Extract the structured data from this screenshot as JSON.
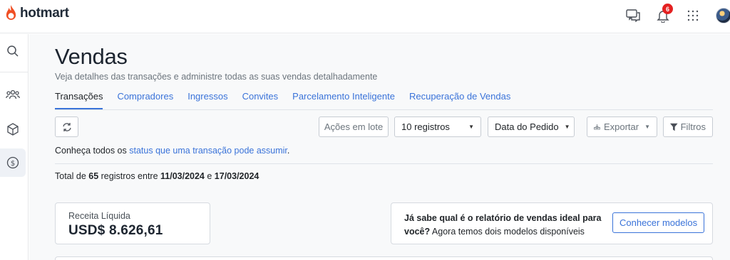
{
  "brand": {
    "name": "hotmart",
    "color": "#f04e23"
  },
  "header": {
    "notifications_count": "6"
  },
  "page": {
    "title": "Vendas",
    "subtitle": "Veja detalhes das transações e administre todas as suas vendas detalhadamente"
  },
  "tabs": [
    {
      "label": "Transações",
      "active": true
    },
    {
      "label": "Compradores"
    },
    {
      "label": "Ingressos"
    },
    {
      "label": "Convites"
    },
    {
      "label": "Parcelamento Inteligente"
    },
    {
      "label": "Recuperação de Vendas"
    }
  ],
  "toolbar": {
    "bulk_actions_label": "Ações em lote",
    "records_label": "10 registros",
    "date_label": "Data do Pedido",
    "export_label": "Exportar",
    "filters_label": "Filtros"
  },
  "info": {
    "prefix": "Conheça todos os ",
    "link": "status que uma transação pode assumir",
    "suffix": "."
  },
  "total": {
    "prefix": "Total de ",
    "count": "65",
    "middle": " registros entre ",
    "start_date": "11/03/2024",
    "conjunction": " e ",
    "end_date": "17/03/2024"
  },
  "revenue": {
    "label": "Receita Líquida",
    "value": "USD$ 8.626,61"
  },
  "promo": {
    "bold_text": "Já sabe qual é o relatório de vendas ideal para você?",
    "text": " Agora temos dois modelos disponíveis",
    "button_label": "Conhecer modelos"
  },
  "colors": {
    "accent": "#3a73d9",
    "badge": "#e42121"
  }
}
